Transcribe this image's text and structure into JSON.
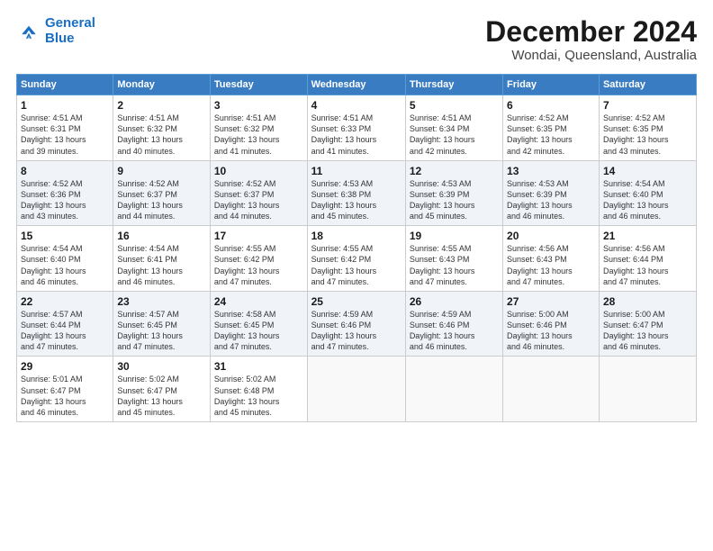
{
  "app": {
    "logo_line1": "General",
    "logo_line2": "Blue"
  },
  "title": "December 2024",
  "subtitle": "Wondai, Queensland, Australia",
  "days_of_week": [
    "Sunday",
    "Monday",
    "Tuesday",
    "Wednesday",
    "Thursday",
    "Friday",
    "Saturday"
  ],
  "weeks": [
    [
      {
        "day": "1",
        "sunrise": "4:51 AM",
        "sunset": "6:31 PM",
        "daylight": "13 hours and 39 minutes."
      },
      {
        "day": "2",
        "sunrise": "4:51 AM",
        "sunset": "6:32 PM",
        "daylight": "13 hours and 40 minutes."
      },
      {
        "day": "3",
        "sunrise": "4:51 AM",
        "sunset": "6:32 PM",
        "daylight": "13 hours and 41 minutes."
      },
      {
        "day": "4",
        "sunrise": "4:51 AM",
        "sunset": "6:33 PM",
        "daylight": "13 hours and 41 minutes."
      },
      {
        "day": "5",
        "sunrise": "4:51 AM",
        "sunset": "6:34 PM",
        "daylight": "13 hours and 42 minutes."
      },
      {
        "day": "6",
        "sunrise": "4:52 AM",
        "sunset": "6:35 PM",
        "daylight": "13 hours and 42 minutes."
      },
      {
        "day": "7",
        "sunrise": "4:52 AM",
        "sunset": "6:35 PM",
        "daylight": "13 hours and 43 minutes."
      }
    ],
    [
      {
        "day": "8",
        "sunrise": "4:52 AM",
        "sunset": "6:36 PM",
        "daylight": "13 hours and 43 minutes."
      },
      {
        "day": "9",
        "sunrise": "4:52 AM",
        "sunset": "6:37 PM",
        "daylight": "13 hours and 44 minutes."
      },
      {
        "day": "10",
        "sunrise": "4:52 AM",
        "sunset": "6:37 PM",
        "daylight": "13 hours and 44 minutes."
      },
      {
        "day": "11",
        "sunrise": "4:53 AM",
        "sunset": "6:38 PM",
        "daylight": "13 hours and 45 minutes."
      },
      {
        "day": "12",
        "sunrise": "4:53 AM",
        "sunset": "6:39 PM",
        "daylight": "13 hours and 45 minutes."
      },
      {
        "day": "13",
        "sunrise": "4:53 AM",
        "sunset": "6:39 PM",
        "daylight": "13 hours and 46 minutes."
      },
      {
        "day": "14",
        "sunrise": "4:54 AM",
        "sunset": "6:40 PM",
        "daylight": "13 hours and 46 minutes."
      }
    ],
    [
      {
        "day": "15",
        "sunrise": "4:54 AM",
        "sunset": "6:40 PM",
        "daylight": "13 hours and 46 minutes."
      },
      {
        "day": "16",
        "sunrise": "4:54 AM",
        "sunset": "6:41 PM",
        "daylight": "13 hours and 46 minutes."
      },
      {
        "day": "17",
        "sunrise": "4:55 AM",
        "sunset": "6:42 PM",
        "daylight": "13 hours and 47 minutes."
      },
      {
        "day": "18",
        "sunrise": "4:55 AM",
        "sunset": "6:42 PM",
        "daylight": "13 hours and 47 minutes."
      },
      {
        "day": "19",
        "sunrise": "4:55 AM",
        "sunset": "6:43 PM",
        "daylight": "13 hours and 47 minutes."
      },
      {
        "day": "20",
        "sunrise": "4:56 AM",
        "sunset": "6:43 PM",
        "daylight": "13 hours and 47 minutes."
      },
      {
        "day": "21",
        "sunrise": "4:56 AM",
        "sunset": "6:44 PM",
        "daylight": "13 hours and 47 minutes."
      }
    ],
    [
      {
        "day": "22",
        "sunrise": "4:57 AM",
        "sunset": "6:44 PM",
        "daylight": "13 hours and 47 minutes."
      },
      {
        "day": "23",
        "sunrise": "4:57 AM",
        "sunset": "6:45 PM",
        "daylight": "13 hours and 47 minutes."
      },
      {
        "day": "24",
        "sunrise": "4:58 AM",
        "sunset": "6:45 PM",
        "daylight": "13 hours and 47 minutes."
      },
      {
        "day": "25",
        "sunrise": "4:59 AM",
        "sunset": "6:46 PM",
        "daylight": "13 hours and 47 minutes."
      },
      {
        "day": "26",
        "sunrise": "4:59 AM",
        "sunset": "6:46 PM",
        "daylight": "13 hours and 46 minutes."
      },
      {
        "day": "27",
        "sunrise": "5:00 AM",
        "sunset": "6:46 PM",
        "daylight": "13 hours and 46 minutes."
      },
      {
        "day": "28",
        "sunrise": "5:00 AM",
        "sunset": "6:47 PM",
        "daylight": "13 hours and 46 minutes."
      }
    ],
    [
      {
        "day": "29",
        "sunrise": "5:01 AM",
        "sunset": "6:47 PM",
        "daylight": "13 hours and 46 minutes."
      },
      {
        "day": "30",
        "sunrise": "5:02 AM",
        "sunset": "6:47 PM",
        "daylight": "13 hours and 45 minutes."
      },
      {
        "day": "31",
        "sunrise": "5:02 AM",
        "sunset": "6:48 PM",
        "daylight": "13 hours and 45 minutes."
      },
      null,
      null,
      null,
      null
    ]
  ],
  "labels": {
    "sunrise": "Sunrise:",
    "sunset": "Sunset:",
    "daylight": "Daylight:"
  }
}
